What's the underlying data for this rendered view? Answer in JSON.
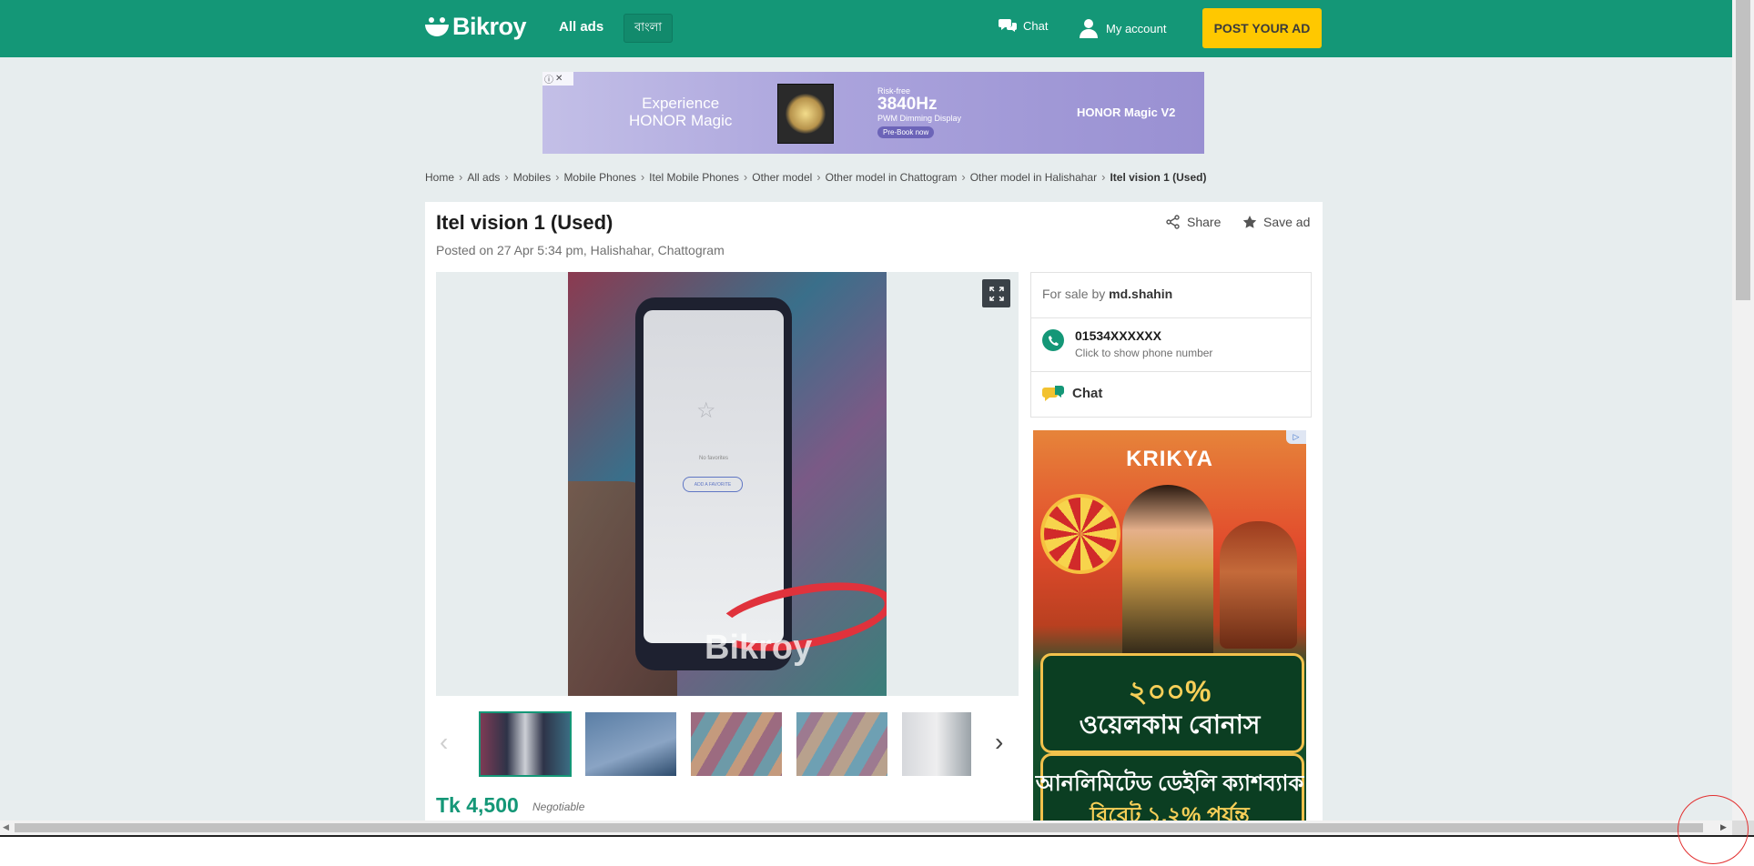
{
  "header": {
    "logo": "Bikroy",
    "all_ads": "All ads",
    "language": "বাংলা",
    "chat": "Chat",
    "account": "My account",
    "post_ad": "POST YOUR AD"
  },
  "banner_ad": {
    "headline_1": "Experience",
    "headline_2": "HONOR Magic",
    "small_1": "Risk-free",
    "big": "3840Hz",
    "small_2": "PWM Dimming Display",
    "cta": "Pre-Book now",
    "brand": "HONOR Magic V2"
  },
  "breadcrumb": [
    "Home",
    "All ads",
    "Mobiles",
    "Mobile Phones",
    "Itel Mobile Phones",
    "Other model",
    "Other model in Chattogram",
    "Other model in Halishahar",
    "Itel vision 1 (Used)"
  ],
  "listing": {
    "title": "Itel vision 1 (Used)",
    "posted": "Posted on 27 Apr 5:34 pm, Halishahar, Chattogram",
    "share": "Share",
    "save": "Save ad",
    "price": "Tk 4,500",
    "negotiable": "Negotiable",
    "photo_screen_text": "No favorites",
    "photo_screen_button": "ADD A FAVORITE",
    "watermark": "Bikroy"
  },
  "seller": {
    "for_sale_by": "For sale by",
    "name": "md.shahin",
    "phone": "01534XXXXXX",
    "phone_hint": "Click to show phone number",
    "chat": "Chat"
  },
  "side_ad": {
    "brand": "KRIKYA",
    "bonus_1": "২০০%",
    "bonus_2": "ওয়েলকাম বোনাস",
    "bonus_3": "আনলিমিটেড ডেইলি ক্যাশব্যাক",
    "bonus_4": "রিবেট ১.২% পর্যন্ত"
  },
  "colors": {
    "brand_green": "#149777",
    "post_button": "#ffc800"
  }
}
